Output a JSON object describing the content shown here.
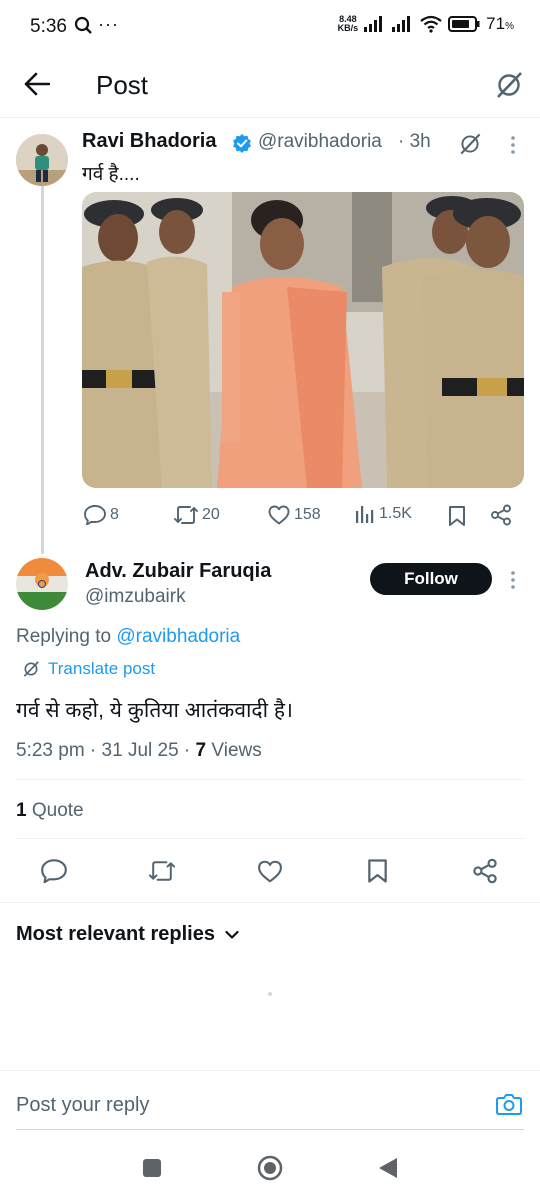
{
  "status": {
    "time": "5:36",
    "net_speed": "8.48",
    "net_unit": "KB/s",
    "battery": "71",
    "battery_unit": "%"
  },
  "header": {
    "title": "Post"
  },
  "parent_post": {
    "author": "Ravi Bhadoria",
    "handle": "@ravibhadoria",
    "time": "· 3h",
    "text": "गर्व है....",
    "replies": "8",
    "reposts": "20",
    "likes": "158",
    "views": "1.5K"
  },
  "main_post": {
    "author": "Adv. Zubair Faruqia",
    "handle": "@imzubairk",
    "follow_label": "Follow",
    "replying_prefix": "Replying to ",
    "replying_to": "@ravibhadoria",
    "translate": "Translate post",
    "text": "गर्व से कहो, ये कुतिया आतंकवादी है।",
    "timestamp": "5:23 pm · 31 Jul 25 · ",
    "views_count": "7",
    "views_label": " Views",
    "quote_count": "1",
    "quote_label": " Quote"
  },
  "replies": {
    "sort_label": "Most relevant replies"
  },
  "composer": {
    "placeholder": "Post your reply"
  },
  "colors": {
    "link": "#1d9bf0",
    "verified": "#1d9bf0",
    "text": "#0f1419",
    "muted": "#536471"
  }
}
